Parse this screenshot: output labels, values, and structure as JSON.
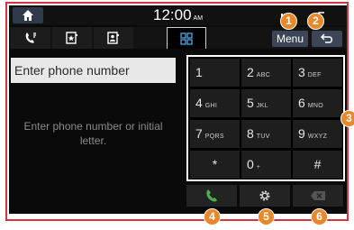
{
  "statusbar": {
    "time": "12:00",
    "ampm": "AM"
  },
  "tabs": [
    {
      "icon": "recent-calls-icon"
    },
    {
      "icon": "favorites-icon"
    },
    {
      "icon": "contacts-icon"
    },
    {
      "icon": "keypad-icon",
      "active": true
    }
  ],
  "toolbar": {
    "menu_label": "Menu",
    "back_icon": "back-icon"
  },
  "dialer": {
    "placeholder": "Enter phone number",
    "hint": "Enter phone number or initial letter."
  },
  "keypad": {
    "keys": [
      {
        "digit": "1",
        "letters": ""
      },
      {
        "digit": "2",
        "letters": "ABC"
      },
      {
        "digit": "3",
        "letters": "DEF"
      },
      {
        "digit": "4",
        "letters": "GHI"
      },
      {
        "digit": "5",
        "letters": "JKL"
      },
      {
        "digit": "6",
        "letters": "MNO"
      },
      {
        "digit": "7",
        "letters": "PQRS"
      },
      {
        "digit": "8",
        "letters": "TUV"
      },
      {
        "digit": "9",
        "letters": "WXYZ"
      },
      {
        "digit": "*",
        "letters": ""
      },
      {
        "digit": "0",
        "letters": "+"
      },
      {
        "digit": "#",
        "letters": ""
      }
    ]
  },
  "bottom_bar": [
    {
      "icon": "call-icon",
      "color": "#4caf50"
    },
    {
      "icon": "settings-icon",
      "color": "#d0d0d0"
    },
    {
      "icon": "delete-icon",
      "color": "#555555"
    }
  ],
  "callouts": [
    "1",
    "2",
    "3",
    "4",
    "5",
    "6"
  ],
  "colors": {
    "accent": "#e8882a",
    "frame": "#d9333f",
    "button_bg": "#3d4656"
  }
}
